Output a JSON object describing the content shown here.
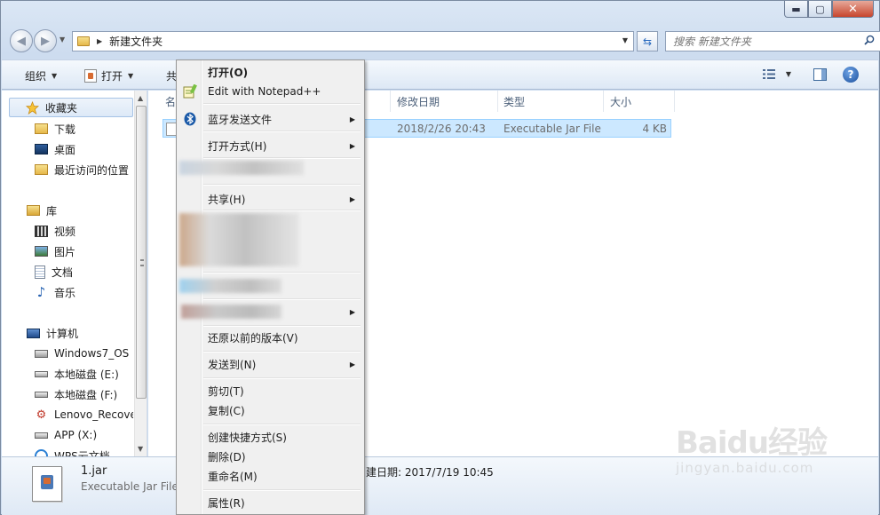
{
  "window": {
    "caption": {
      "minimize": "▬",
      "maximize": "▢",
      "close": "✕"
    }
  },
  "address": {
    "path": "新建文件夹",
    "search_placeholder": "搜索 新建文件夹"
  },
  "toolbar": {
    "organize": "组织",
    "open": "打开",
    "share": "共"
  },
  "nav": {
    "favorites": "收藏夹",
    "downloads": "下载",
    "desktop": "桌面",
    "recent": "最近访问的位置",
    "libraries": "库",
    "videos": "视频",
    "pictures": "图片",
    "documents": "文档",
    "music": "音乐",
    "computer": "计算机",
    "drives": [
      "Windows7_OS (",
      "本地磁盘 (E:)",
      "本地磁盘 (F:)",
      "Lenovo_Recove",
      "APP (X:)",
      "WPS云文档"
    ]
  },
  "columns": {
    "name": "名",
    "date": "修改日期",
    "type": "类型",
    "size": "大小"
  },
  "file": {
    "date": "2018/2/26 20:43",
    "type": "Executable Jar File",
    "size": "4 KB"
  },
  "details": {
    "name": "1.jar",
    "type": "Executable Jar File",
    "created": "建日期: 2017/7/19 10:45"
  },
  "context_menu": {
    "open": "打开(O)",
    "notepad": "Edit with Notepad++",
    "bluetooth": "蓝牙发送文件",
    "open_with": "打开方式(H)",
    "share": "共享(H)",
    "restore": "还原以前的版本(V)",
    "send_to": "发送到(N)",
    "cut": "剪切(T)",
    "copy": "复制(C)",
    "shortcut": "创建快捷方式(S)",
    "delete": "删除(D)",
    "rename": "重命名(M)",
    "properties": "属性(R)",
    "submenu_arrow": "▶"
  },
  "watermark": {
    "logo": "Baidu经验",
    "url": "jingyan.baidu.com"
  },
  "colors": {
    "selection": "#cce8ff",
    "menu_bg": "#f0f0f0",
    "chrome": "#dbe7f5"
  }
}
